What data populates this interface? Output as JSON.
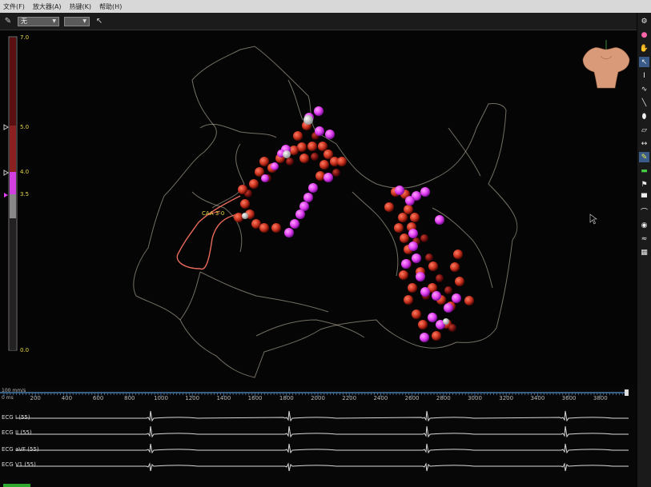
{
  "menu": {
    "items": [
      "文件(F)",
      "放大器(A)",
      "热键(K)",
      "帮助(H)"
    ]
  },
  "toolbar": {
    "dropdown1": "无",
    "dropdown2": ""
  },
  "scale": {
    "max": "7.0",
    "v5": "5.0",
    "v4": "4.0",
    "v35": "3.5",
    "min": "0.0"
  },
  "map": {
    "label": "CAA 3-0"
  },
  "colors": {
    "red": "#c8321e",
    "magenta": "#e040f0",
    "label": "#e8d84a",
    "pink_trace": "#e86a5a"
  },
  "waves": {
    "speed": "100 mm/s",
    "unit": "0 ms",
    "ticks": [
      "200",
      "400",
      "600",
      "800",
      "1000",
      "1200",
      "1400",
      "1600",
      "1800",
      "2000",
      "2200",
      "2400",
      "2600",
      "2800",
      "3000",
      "3200",
      "3400",
      "3600",
      "3800"
    ],
    "leads": [
      "ECG I (55)",
      "ECG II (55)",
      "ECG aVF (55)",
      "ECG V1 (55)"
    ]
  }
}
